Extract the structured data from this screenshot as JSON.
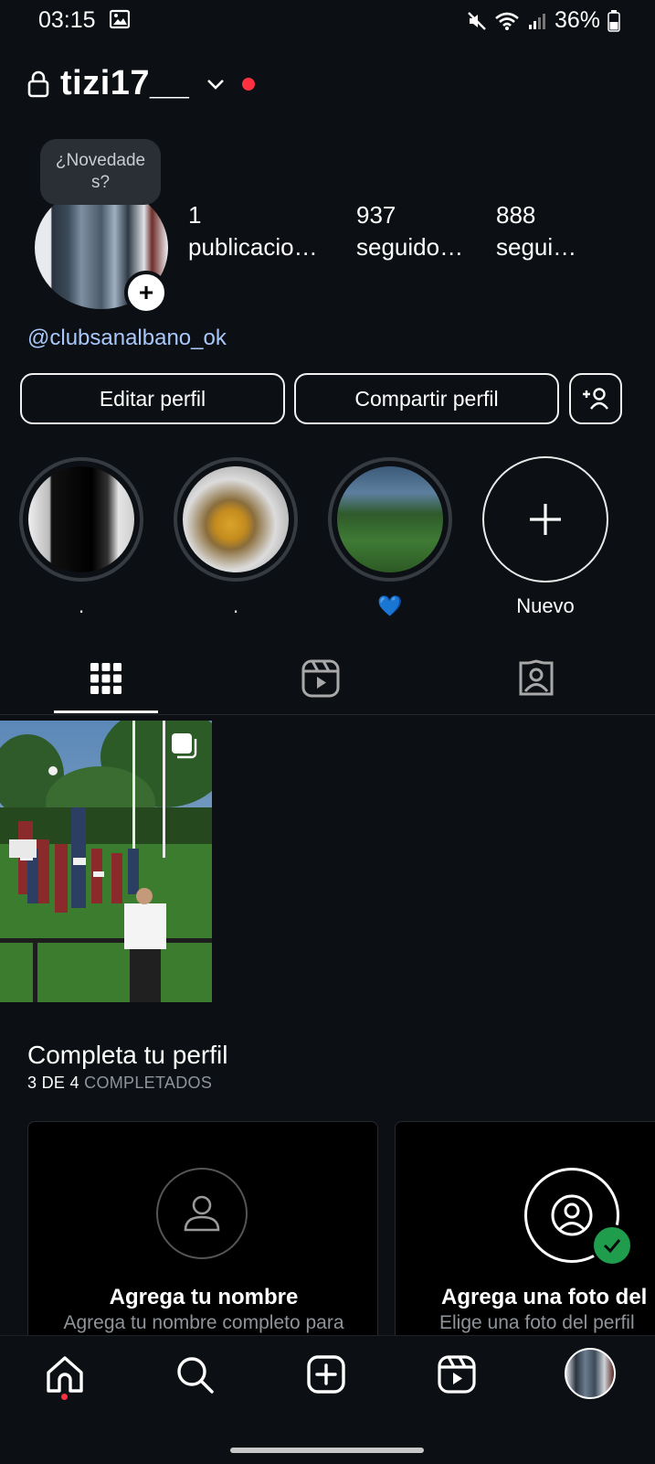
{
  "status_bar": {
    "time": "03:15",
    "battery": "36%",
    "icons": [
      "image-icon",
      "mute-icon",
      "wifi-icon",
      "signal-icon",
      "battery-icon"
    ]
  },
  "header": {
    "username": "tizi17__",
    "icons": [
      "lock-icon",
      "chevron-down-icon"
    ],
    "notification_color": "#ff3040"
  },
  "profile": {
    "tooltip": "¿Novedade\ns?",
    "stats": [
      {
        "value": "1",
        "label": "publicacio…"
      },
      {
        "value": "937",
        "label": "seguido…"
      },
      {
        "value": "888",
        "label": "segui…"
      }
    ],
    "link": "@clubsanalbano_ok"
  },
  "buttons": {
    "edit": "Editar perfil",
    "share": "Compartir perfil",
    "discover_icon": "add-person-icon"
  },
  "highlights": [
    {
      "label": "."
    },
    {
      "label": "."
    },
    {
      "label": "💙"
    },
    {
      "label": "Nuevo"
    }
  ],
  "tabs": [
    {
      "name": "grid",
      "icon": "grid-icon",
      "active": true
    },
    {
      "name": "reels",
      "icon": "reels-icon",
      "active": false
    },
    {
      "name": "tagged",
      "icon": "tagged-icon",
      "active": false
    }
  ],
  "complete_profile": {
    "title": "Completa tu perfil",
    "progress_count": "3 DE 4",
    "progress_word": "COMPLETADOS",
    "cards": [
      {
        "title": "Agrega tu nombre",
        "desc": "Agrega tu nombre completo para",
        "icon": "person-icon",
        "done": false
      },
      {
        "title": "Agrega una foto del",
        "desc": "Elige una foto del perfil",
        "icon": "profile-photo-icon",
        "done": true
      }
    ]
  },
  "bottom_nav": [
    "home-icon",
    "search-icon",
    "create-icon",
    "reels-icon",
    "profile-avatar"
  ],
  "colors": {
    "background": "#0c1014",
    "link": "#a8c7fa",
    "done_badge": "#1f9d4c"
  }
}
